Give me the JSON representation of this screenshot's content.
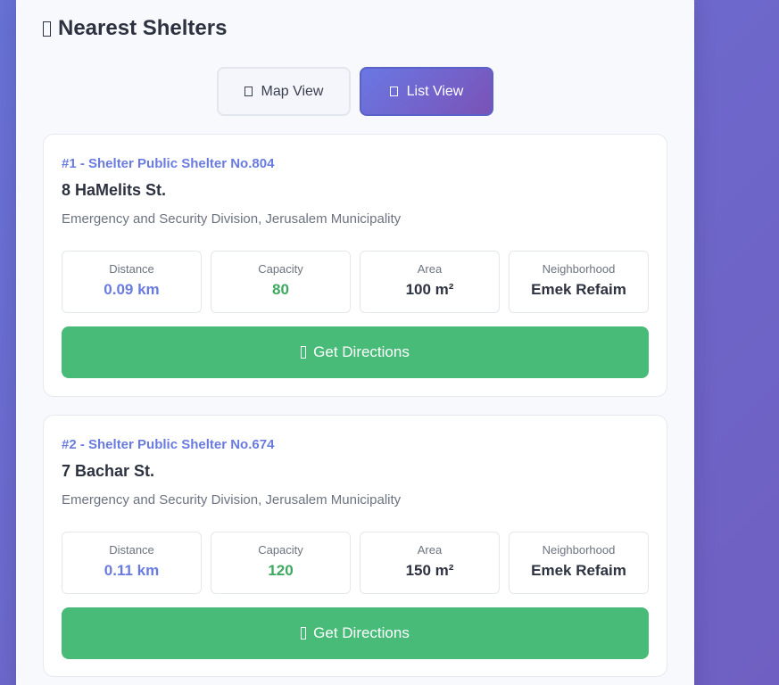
{
  "panel": {
    "title": "Nearest Shelters",
    "title_icon": "shelter-icon"
  },
  "view_toggle": {
    "map_label": "Map View",
    "map_icon": "map-icon",
    "list_label": "List View",
    "list_icon": "list-icon",
    "active": "List View"
  },
  "colors": {
    "accent": "#6a7be0",
    "capacity_green": "#3ea860",
    "directions_button": "#48bb78"
  },
  "shelters": [
    {
      "id_line": "#1 - Shelter Public Shelter No.804",
      "address": "8 HaMelits St.",
      "organization": "Emergency and Security Division, Jerusalem Municipality",
      "stats": [
        {
          "label": "Distance",
          "value": "0.09 km"
        },
        {
          "label": "Capacity",
          "value": "80"
        },
        {
          "label": "Area",
          "value": "100 m²"
        },
        {
          "label": "Neighborhood",
          "value": "Emek Refaim"
        }
      ],
      "directions_label": "Get Directions",
      "directions_icon": "directions-icon"
    },
    {
      "id_line": "#2 - Shelter Public Shelter No.674",
      "address": "7 Bachar St.",
      "organization": "Emergency and Security Division, Jerusalem Municipality",
      "stats": [
        {
          "label": "Distance",
          "value": "0.11 km"
        },
        {
          "label": "Capacity",
          "value": "120"
        },
        {
          "label": "Area",
          "value": "150 m²"
        },
        {
          "label": "Neighborhood",
          "value": "Emek Refaim"
        }
      ],
      "directions_label": "Get Directions",
      "directions_icon": "directions-icon"
    }
  ]
}
